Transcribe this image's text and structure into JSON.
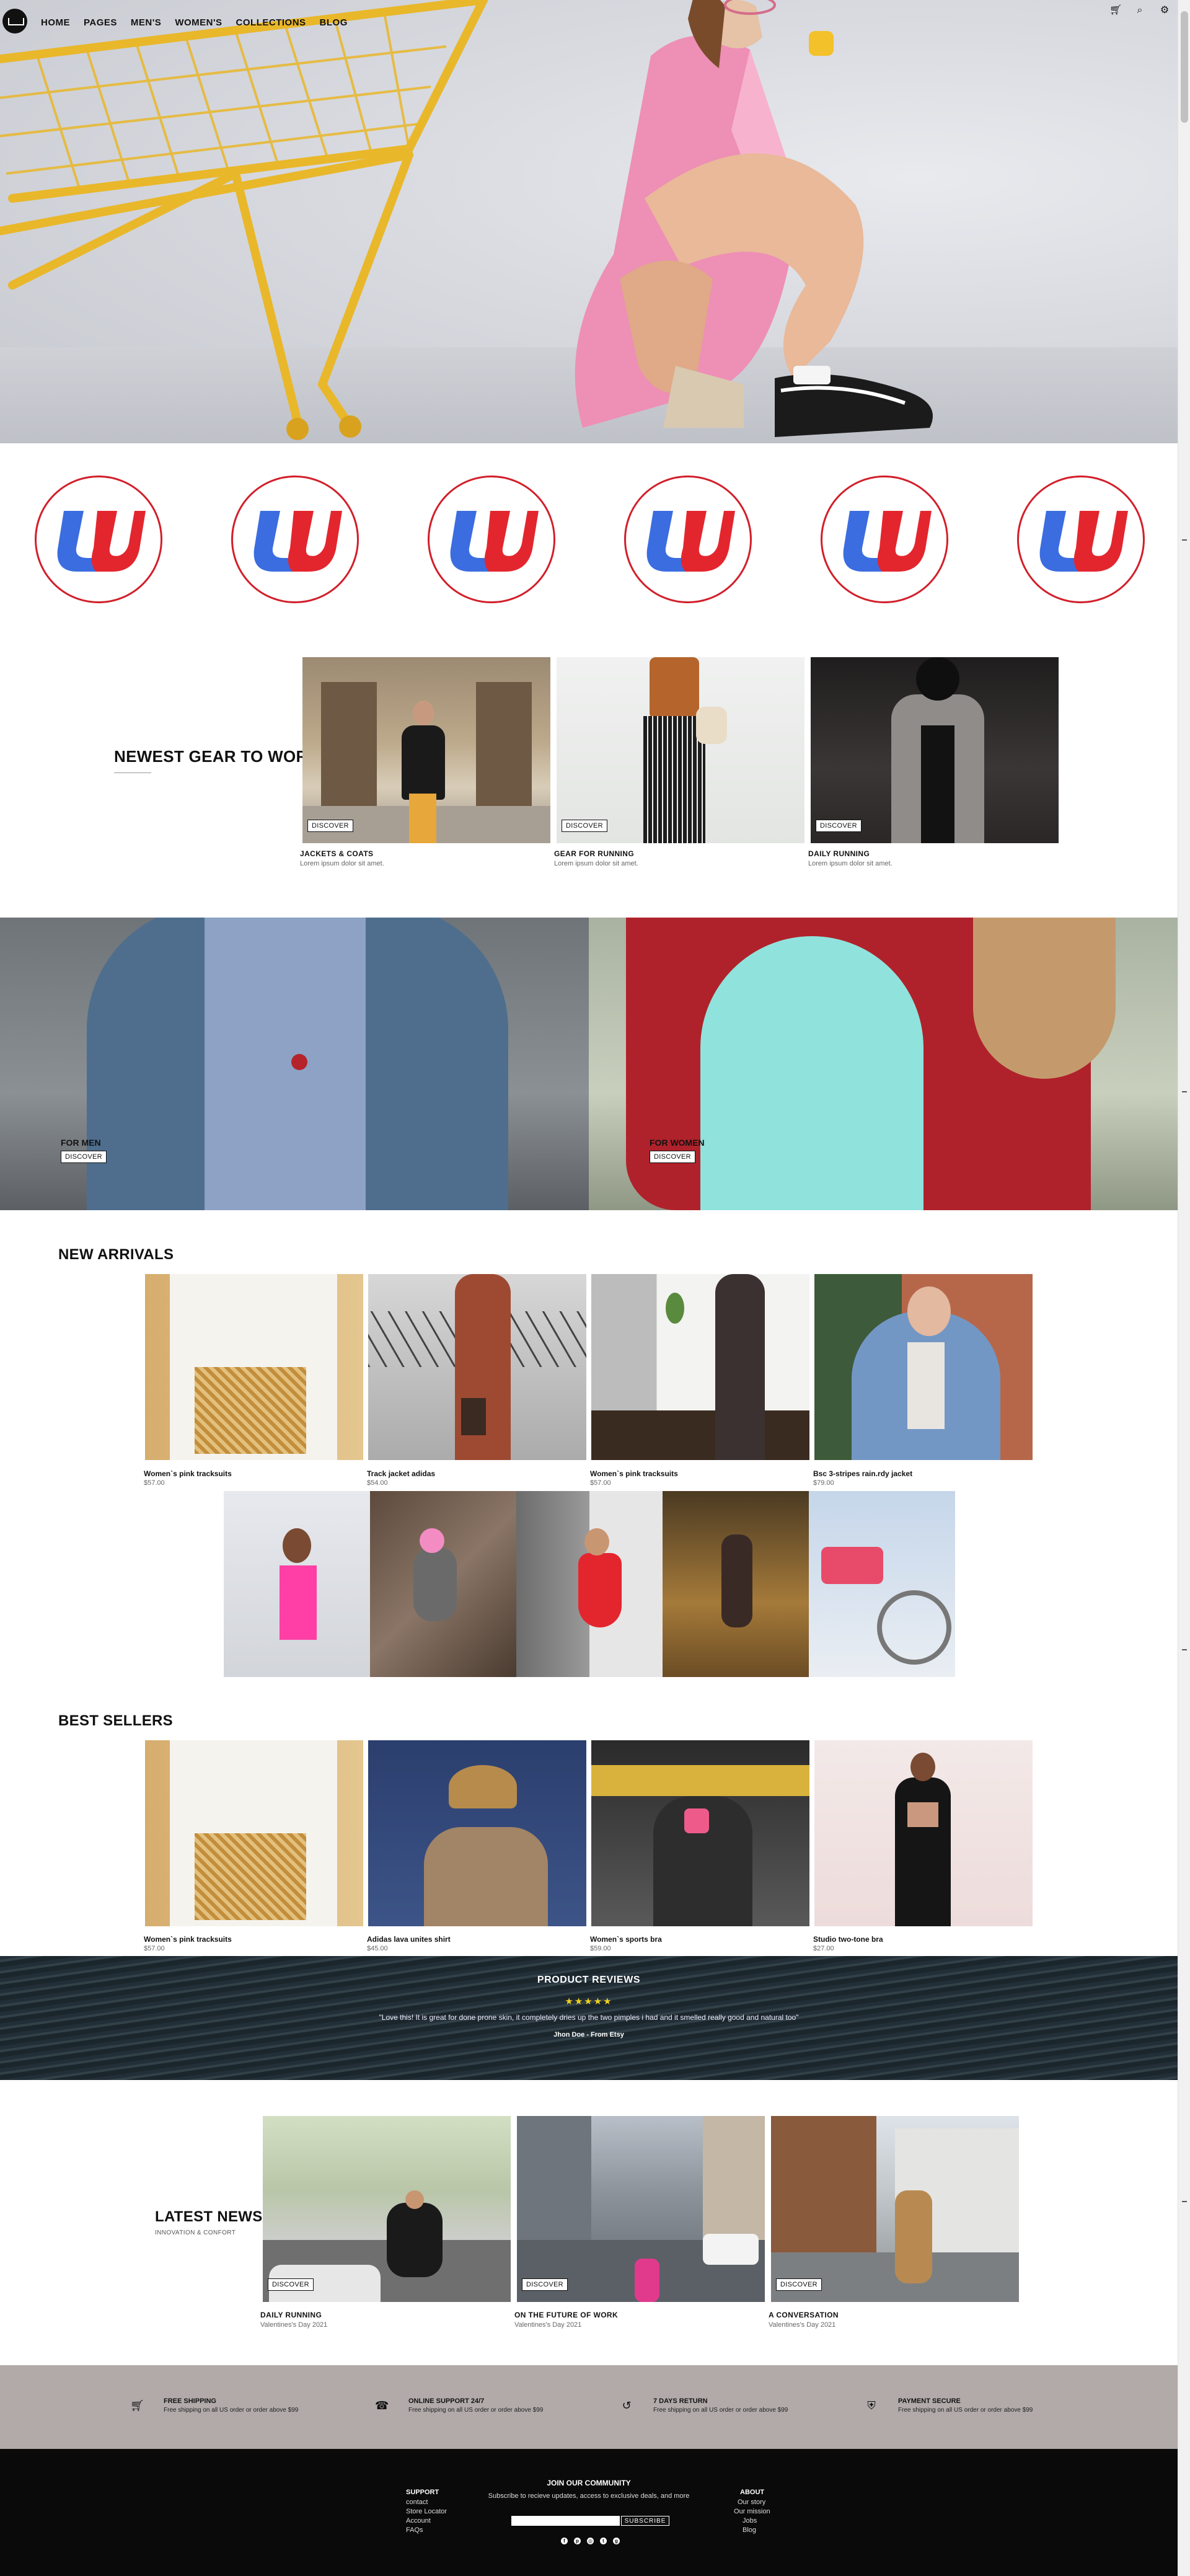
{
  "nav": {
    "links": [
      "HOME",
      "PAGES",
      "MEN'S",
      "WOMEN'S",
      "COLLECTIONS",
      "BLOG"
    ],
    "icons": [
      "cart-icon",
      "search-icon",
      "gear-icon"
    ]
  },
  "newest_gear": {
    "title": "NEWEST GEAR TO WORK",
    "cards": [
      {
        "title": "JACKETS & COATS",
        "subtitle": "Lorem ipsum dolor sit amet.",
        "button": "DISCOVER"
      },
      {
        "title": "GEAR FOR RUNNING",
        "subtitle": "Lorem ipsum dolor sit amet.",
        "button": "DISCOVER"
      },
      {
        "title": "DAILY RUNNING",
        "subtitle": "Lorem ipsum dolor sit amet.",
        "button": "DISCOVER"
      }
    ]
  },
  "men_women": [
    {
      "label": "FOR MEN",
      "button": "DISCOVER"
    },
    {
      "label": "FOR WOMEN",
      "button": "DISCOVER"
    }
  ],
  "new_arrivals": {
    "title": "NEW ARRIVALS",
    "products": [
      {
        "name": "Women`s pink tracksuits",
        "price": "$57.00"
      },
      {
        "name": "Track jacket adidas",
        "price": "$54.00"
      },
      {
        "name": "Women`s pink tracksuits",
        "price": "$57.00"
      },
      {
        "name": "Bsc 3-stripes rain.rdy jacket",
        "price": "$79.00"
      }
    ]
  },
  "best_sellers": {
    "title": "BEST SELLERS",
    "products": [
      {
        "name": "Women`s pink tracksuits",
        "price": "$57.00"
      },
      {
        "name": "Adidas lava unites shirt",
        "price": "$45.00"
      },
      {
        "name": "Women`s sports bra",
        "price": "$59.00"
      },
      {
        "name": "Studio two-tone bra",
        "price": "$27.00"
      }
    ]
  },
  "reviews": {
    "title": "PRODUCT REVIEWS",
    "stars": "★★★★★",
    "quote": "\"Love this! It is great for done prone skin, it completely dries up the two pimples i had and it smelled really good and natural too\"",
    "author": "Jhon Doe - From Etsy"
  },
  "latest_news": {
    "title": "LATEST NEWS",
    "subtitle": "INNOVATION & CONFORT",
    "cards": [
      {
        "title": "DAILY RUNNING",
        "date": "Valentines's Day 2021",
        "button": "DISCOVER"
      },
      {
        "title": "ON THE FUTURE OF WORK",
        "date": "Valentines's Day 2021",
        "button": "DISCOVER"
      },
      {
        "title": "A CONVERSATION",
        "date": "Valentines's Day 2021",
        "button": "DISCOVER"
      }
    ]
  },
  "features": [
    {
      "icon": "cart-icon",
      "title": "FREE SHIPPING",
      "text": "Free shipping on all US order or order above $99"
    },
    {
      "icon": "phone-icon",
      "title": "ONLINE SUPPORT 24/7",
      "text": "Free shipping on all US order or order above $99"
    },
    {
      "icon": "return-icon",
      "title": "7 DAYS RETURN",
      "text": "Free shipping on all US order or order above $99"
    },
    {
      "icon": "shield-icon",
      "title": "PAYMENT SECURE",
      "text": "Free shipping on all US order or order above $99"
    }
  ],
  "footer": {
    "support_title": "SUPPORT",
    "support_links": [
      "contact",
      "Store Locator",
      "Account",
      "FAQs"
    ],
    "join_title": "JOIN OUR COMMUNITY",
    "join_text": "Subscribe to recieve updates, access to exclusive deals, and more",
    "subscribe_label": "SUBSCRIBE",
    "about_title": "ABOUT",
    "about_links": [
      "Our story",
      "Our mission",
      "Jobs",
      "Blog"
    ],
    "social_icons": [
      "facebook-icon",
      "pinterest-icon",
      "instagram-icon",
      "twitter-icon",
      "google-plus-icon"
    ]
  },
  "colors": {
    "accent_red": "#d21f2a",
    "brand_blue": "#3b6de0",
    "feature_bar": "#b1aaa9",
    "footer_bg": "#0a0a0a"
  }
}
